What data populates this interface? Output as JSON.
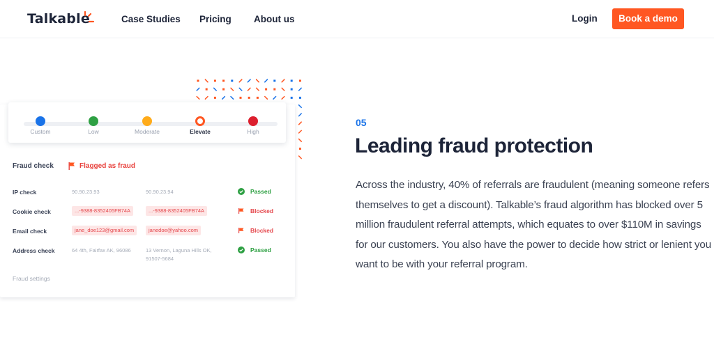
{
  "header": {
    "logo": "Talkable",
    "nav": [
      "Case Studies",
      "Pricing",
      "About us"
    ],
    "login": "Login",
    "cta": "Book a demo",
    "cta_color": "#ff5722"
  },
  "widget": {
    "levels": [
      {
        "label": "Custom",
        "color": "#1a73e8",
        "active": false
      },
      {
        "label": "Low",
        "color": "#2ea043",
        "active": false
      },
      {
        "label": "Moderate",
        "color": "#ffab1a",
        "active": false
      },
      {
        "label": "Elevate",
        "color": "#ff5722",
        "active": true
      },
      {
        "label": "High",
        "color": "#dc1f2e",
        "active": false
      }
    ],
    "fraud_check": {
      "label": "Fraud check",
      "status": "Flagged as fraud",
      "status_icon": "flag-icon"
    },
    "rows": [
      {
        "label": "IP check",
        "a": "90.90.23.93",
        "b": "90.90.23.94",
        "b2": "",
        "tagged": false,
        "result": "Passed",
        "result_icon": "check-circle-icon"
      },
      {
        "label": "Cookie check",
        "a": "...-9388-8352405FB74A",
        "b": "...-9388-8352405FB74A",
        "b2": "",
        "tagged": true,
        "result": "Blocked",
        "result_icon": "flag-icon"
      },
      {
        "label": "Email check",
        "a": "jane_doe123@gmail.com",
        "b": "janedoe@yahoo.com",
        "b2": "",
        "tagged": true,
        "result": "Blocked",
        "result_icon": "flag-icon"
      },
      {
        "label": "Address check",
        "a": "64 4th, Fairfax AK, 96086",
        "b": "13 Vernon, Laguna Hills OK,",
        "b2": "91507-5684",
        "tagged": false,
        "result": "Passed",
        "result_icon": "check-circle-icon"
      }
    ],
    "settings_link": "Fraud settings"
  },
  "section": {
    "number": "05",
    "title": "Leading fraud protection",
    "body": "Across the industry, 40% of referrals are fraudulent (meaning someone refers themselves to get a discount). Talkable’s fraud algorithm has blocked over 5 million fraudulent referral attempts, which equates to over $110M in savings for our customers. You also have the power to decide how strict or lenient you want to be with your referral program."
  }
}
